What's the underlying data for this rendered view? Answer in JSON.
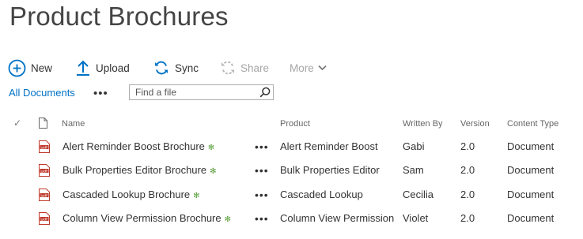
{
  "page": {
    "title": "Product Brochures"
  },
  "toolbar": {
    "new_label": "New",
    "upload_label": "Upload",
    "sync_label": "Sync",
    "share_label": "Share",
    "more_label": "More"
  },
  "view": {
    "current_view": "All Documents",
    "more_views": "•••",
    "search_placeholder": "Find a file"
  },
  "columns": {
    "select": "✓",
    "name": "Name",
    "product": "Product",
    "written_by": "Written By",
    "version": "Version",
    "content_type": "Content Type"
  },
  "rows": [
    {
      "name": "Alert Reminder Boost Brochure",
      "new_marker": "✻",
      "menu": "•••",
      "product": "Alert Reminder Boost",
      "written_by": "Gabi",
      "version": "2.0",
      "content_type": "Document",
      "icon": "pdf-icon"
    },
    {
      "name": "Bulk Properties Editor Brochure",
      "new_marker": "✻",
      "menu": "•••",
      "product": "Bulk Properties Editor",
      "written_by": "Sam",
      "version": "2.0",
      "content_type": "Document",
      "icon": "pdf-icon"
    },
    {
      "name": "Cascaded Lookup Brochure",
      "new_marker": "✻",
      "menu": "•••",
      "product": "Cascaded Lookup",
      "written_by": "Cecilia",
      "version": "2.0",
      "content_type": "Document",
      "icon": "pdf-icon"
    },
    {
      "name": "Column View Permission Brochure",
      "new_marker": "✻",
      "menu": "•••",
      "product": "Column View Permission",
      "written_by": "Violet",
      "version": "2.0",
      "content_type": "Document",
      "icon": "pdf-icon"
    }
  ],
  "colors": {
    "accent": "#0072c6",
    "new_badge": "#5a9e3b",
    "pdf": "#c0392b",
    "disabled": "#a6a6a6"
  }
}
